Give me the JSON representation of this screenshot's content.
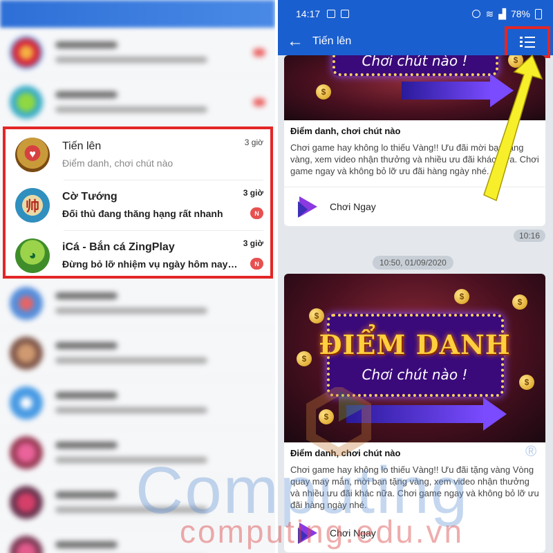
{
  "left_panel": {
    "highlighted_chats": [
      {
        "title": "Tiến lên",
        "subtitle": "Điểm danh, chơi chút nào",
        "time": "3 giờ",
        "unread": false,
        "avatar_icon": "tien-len-game-avatar"
      },
      {
        "title": "Cờ Tướng",
        "subtitle": "Đối thủ đang thăng hạng rất nhanh",
        "time": "3 giờ",
        "unread": true,
        "badge": "N",
        "avatar_text": "帅",
        "avatar_icon": "co-tuong-game-avatar"
      },
      {
        "title": "iCá - Bắn cá ZingPlay",
        "subtitle": "Đừng bỏ lỡ nhiệm vụ ngày hôm nay! Vào g...",
        "time": "3 giờ",
        "unread": true,
        "badge": "N",
        "avatar_icon": "ica-game-avatar"
      }
    ],
    "highlight_color": "#e32626"
  },
  "right_panel": {
    "status_bar": {
      "time": "14:17",
      "battery": "78%"
    },
    "header": {
      "title": "Tiến lên",
      "back_icon": "arrow-left-icon",
      "menu_icon": "list-menu-icon"
    },
    "card1": {
      "banner_text": "Chơi chút nào !",
      "title": "Điểm danh, chơi chút nào",
      "description": "Chơi game hay không lo thiếu Vàng!! Ưu đãi mời bạn tặng vàng, xem video nhận thưởng và nhiều ưu đãi khác nữa. Chơi game ngay và không bỏ lỡ ưu đãi hàng ngày nhé.",
      "action": "Chơi Ngay",
      "time": "10:16"
    },
    "date_chip": "10:50, 01/09/2020",
    "card2": {
      "banner_title": "ĐIỂM DANH",
      "banner_sub": "Chơi chút nào !",
      "title": "Điểm danh, chơi chút nào",
      "description": "Chơi game hay không lo thiếu Vàng!! Ưu đãi tặng vàng Vòng quay may mắn, mời bạn tặng vàng, xem video nhận thưởng và nhiều ưu đãi khác nữa. Chơi game ngay và không bỏ lỡ ưu đãi hàng ngày nhé.",
      "action": "Chơi Ngay"
    },
    "theme_color": "#1a5fcf"
  },
  "watermark": {
    "big": "Computing",
    "small": "computing.edu.vn",
    "reg": "®"
  }
}
